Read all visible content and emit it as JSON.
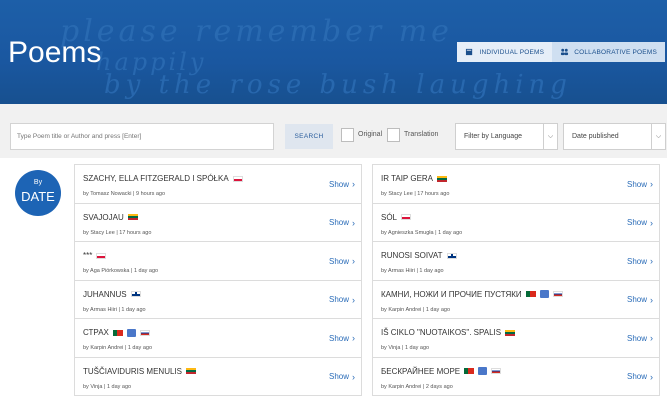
{
  "header": {
    "title": "Poems",
    "handwriting": [
      "please remember me",
      "happily",
      "by the rose bush laughing"
    ],
    "tabs": [
      {
        "label": "INDIVIDUAL POEMS",
        "icon": "book-icon",
        "active": true
      },
      {
        "label": "COLLABORATIVE POEMS",
        "icon": "people-icon",
        "active": false
      }
    ]
  },
  "filters": {
    "search_placeholder": "Type Poem title or Author and press [Enter]",
    "search_button": "SEARCH",
    "original_label": "Original",
    "translation_label": "Translation",
    "language_select": "Filter by Language",
    "sort_select": "Date published"
  },
  "date_badge": {
    "by": "By",
    "label": "DATE"
  },
  "show_label": "Show",
  "poems_left": [
    {
      "title": "SZACHY, ELLA FITZGERALD I SPÓŁKA",
      "meta": "by Tomasz Nowacki | 9 hours ago",
      "flags": [
        "pl"
      ]
    },
    {
      "title": "SVAJOJAU",
      "meta": "by Stacy Lee | 17 hours ago",
      "flags": [
        "lt"
      ]
    },
    {
      "title": "***",
      "meta": "by Aga Piórkowska | 1 day ago",
      "flags": [
        "pl"
      ]
    },
    {
      "title": "JUHANNUS",
      "meta": "by Armas Hiiri | 1 day ago",
      "flags": [
        "fi"
      ]
    },
    {
      "title": "СТРАХ",
      "meta": "by Karpin Andrei | 1 day ago",
      "flags": [
        "pt",
        "tr",
        "ru"
      ]
    },
    {
      "title": "TUŠČIAVIDURIS MENULIS",
      "meta": "by Vinja | 1 day ago",
      "flags": [
        "lt"
      ]
    }
  ],
  "poems_right": [
    {
      "title": "IR TAIP GERA",
      "meta": "by Stacy Lee | 17 hours ago",
      "flags": [
        "lt"
      ]
    },
    {
      "title": "SÓL",
      "meta": "by Agnieszka Smugła | 1 day ago",
      "flags": [
        "pl"
      ]
    },
    {
      "title": "RUNOSI SOIVAT",
      "meta": "by Armas Hiiri | 1 day ago",
      "flags": [
        "fi"
      ]
    },
    {
      "title": "КАМНИ, НОЖИ И ПРОЧИЕ ПУСТЯКИ",
      "meta": "by Karpin Andrei | 1 day ago",
      "flags": [
        "pt",
        "tr",
        "ru"
      ]
    },
    {
      "title": "IŠ CIKLO \"NUOTAIKOS\". SPALIS",
      "meta": "by Vinja | 1 day ago",
      "flags": [
        "lt"
      ]
    },
    {
      "title": "БЕСКРАЙНЕЕ МОРЕ",
      "meta": "by Karpin Andrei | 2 days ago",
      "flags": [
        "pt",
        "tr",
        "ru"
      ]
    }
  ]
}
